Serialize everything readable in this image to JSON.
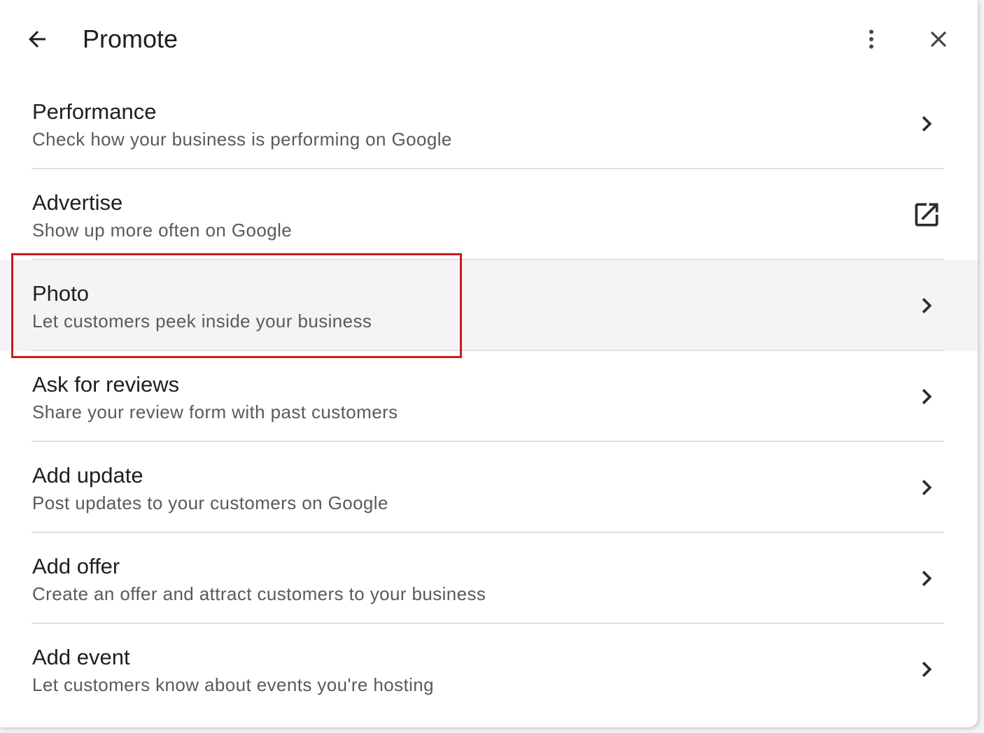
{
  "header": {
    "title": "Promote",
    "back_icon": "arrow-left-icon",
    "more_icon": "more-vertical-icon",
    "close_icon": "close-icon"
  },
  "items": [
    {
      "label": "Performance",
      "sub": "Check how your business is performing on Google",
      "trail_icon": "chevron-right-icon"
    },
    {
      "label": "Advertise",
      "sub": "Show up more often on Google",
      "trail_icon": "open-in-new-icon"
    },
    {
      "label": "Photo",
      "sub": "Let customers peek inside your business",
      "trail_icon": "chevron-right-icon",
      "highlighted": true
    },
    {
      "label": "Ask for reviews",
      "sub": "Share your review form with past customers",
      "trail_icon": "chevron-right-icon"
    },
    {
      "label": "Add update",
      "sub": "Post updates to your customers on Google",
      "trail_icon": "chevron-right-icon"
    },
    {
      "label": "Add offer",
      "sub": "Create an offer and attract customers to your business",
      "trail_icon": "chevron-right-icon"
    },
    {
      "label": "Add event",
      "sub": "Let customers know about events you're hosting",
      "trail_icon": "chevron-right-icon"
    }
  ],
  "colors": {
    "highlight_box": "#cc1a1a",
    "row_highlight": "#f6f3f7",
    "text_primary": "#1f1f1f",
    "text_secondary": "#5a5a5d"
  }
}
